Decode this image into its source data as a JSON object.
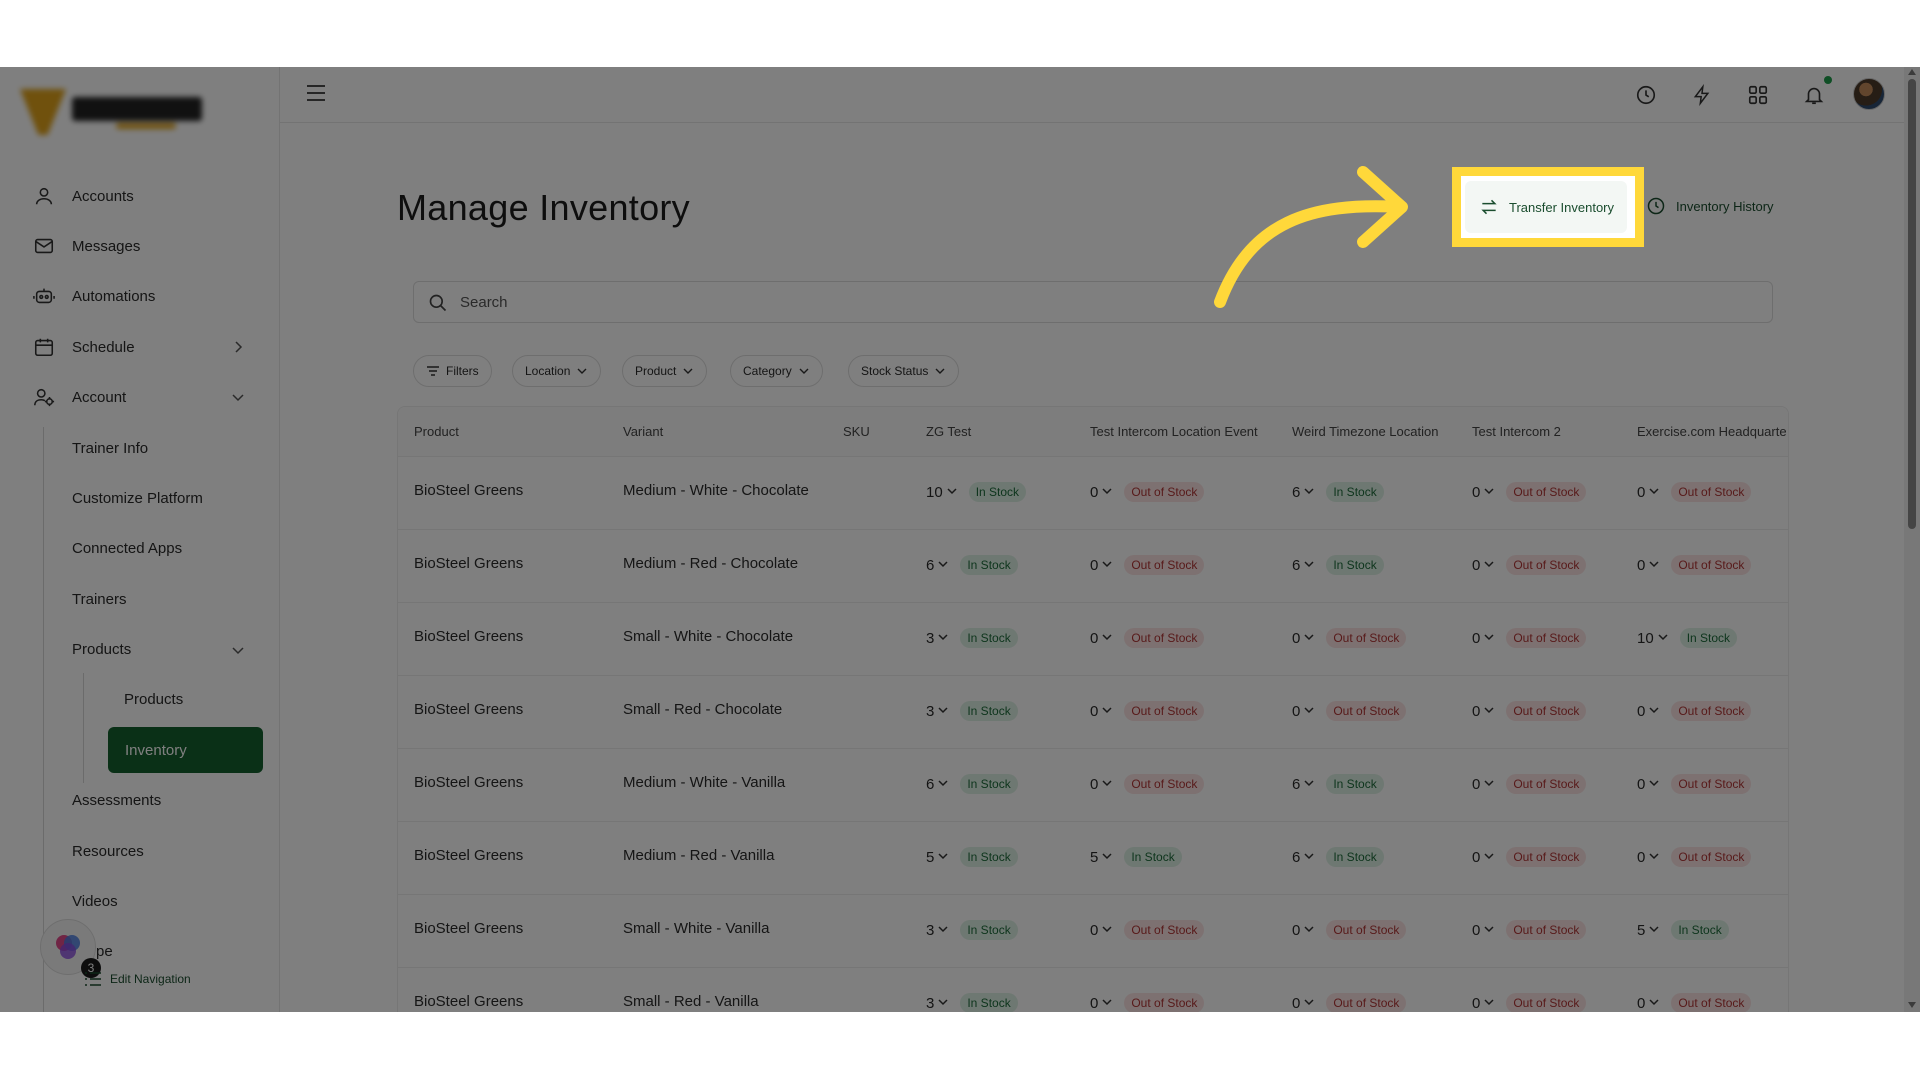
{
  "sidebar": {
    "items": [
      {
        "label": "Accounts",
        "icon": "user-icon"
      },
      {
        "label": "Messages",
        "icon": "mail-icon"
      },
      {
        "label": "Automations",
        "icon": "robot-icon"
      },
      {
        "label": "Schedule",
        "icon": "calendar-icon"
      },
      {
        "label": "Account",
        "icon": "user-gear-icon"
      }
    ],
    "account_sub": [
      "Trainer Info",
      "Customize Platform",
      "Connected Apps",
      "Trainers",
      "Products",
      "Assessments",
      "Resources",
      "Videos"
    ],
    "products_sub": [
      "Products",
      "Inventory"
    ],
    "partial_item": "pe",
    "edit_navigation": "Edit Navigation",
    "helper_count": "3"
  },
  "page": {
    "title": "Manage Inventory",
    "transfer_label": "Transfer Inventory",
    "history_label": "Inventory History",
    "search_placeholder": "Search"
  },
  "filters": [
    "Filters",
    "Location",
    "Product",
    "Category",
    "Stock Status"
  ],
  "table": {
    "columns": [
      "Product",
      "Variant",
      "SKU",
      "ZG Test",
      "Test Intercom Location Event",
      "Weird Timezone Location",
      "Test Intercom 2",
      "Exercise.com Headquarte"
    ],
    "rows": [
      {
        "product": "BioSteel Greens",
        "variant": "Medium - White - Chocolate",
        "sku": "",
        "stock": [
          {
            "qty": "10",
            "status": "In Stock"
          },
          {
            "qty": "0",
            "status": "Out of Stock"
          },
          {
            "qty": "6",
            "status": "In Stock"
          },
          {
            "qty": "0",
            "status": "Out of Stock"
          },
          {
            "qty": "0",
            "status": "Out of Stock"
          }
        ]
      },
      {
        "product": "BioSteel Greens",
        "variant": "Medium - Red - Chocolate",
        "sku": "",
        "stock": [
          {
            "qty": "6",
            "status": "In Stock"
          },
          {
            "qty": "0",
            "status": "Out of Stock"
          },
          {
            "qty": "6",
            "status": "In Stock"
          },
          {
            "qty": "0",
            "status": "Out of Stock"
          },
          {
            "qty": "0",
            "status": "Out of Stock"
          }
        ]
      },
      {
        "product": "BioSteel Greens",
        "variant": "Small - White - Chocolate",
        "sku": "",
        "stock": [
          {
            "qty": "3",
            "status": "In Stock"
          },
          {
            "qty": "0",
            "status": "Out of Stock"
          },
          {
            "qty": "0",
            "status": "Out of Stock"
          },
          {
            "qty": "0",
            "status": "Out of Stock"
          },
          {
            "qty": "10",
            "status": "In Stock"
          }
        ]
      },
      {
        "product": "BioSteel Greens",
        "variant": "Small - Red - Chocolate",
        "sku": "",
        "stock": [
          {
            "qty": "3",
            "status": "In Stock"
          },
          {
            "qty": "0",
            "status": "Out of Stock"
          },
          {
            "qty": "0",
            "status": "Out of Stock"
          },
          {
            "qty": "0",
            "status": "Out of Stock"
          },
          {
            "qty": "0",
            "status": "Out of Stock"
          }
        ]
      },
      {
        "product": "BioSteel Greens",
        "variant": "Medium - White - Vanilla",
        "sku": "",
        "stock": [
          {
            "qty": "6",
            "status": "In Stock"
          },
          {
            "qty": "0",
            "status": "Out of Stock"
          },
          {
            "qty": "6",
            "status": "In Stock"
          },
          {
            "qty": "0",
            "status": "Out of Stock"
          },
          {
            "qty": "0",
            "status": "Out of Stock"
          }
        ]
      },
      {
        "product": "BioSteel Greens",
        "variant": "Medium - Red - Vanilla",
        "sku": "",
        "stock": [
          {
            "qty": "5",
            "status": "In Stock"
          },
          {
            "qty": "5",
            "status": "In Stock"
          },
          {
            "qty": "6",
            "status": "In Stock"
          },
          {
            "qty": "0",
            "status": "Out of Stock"
          },
          {
            "qty": "0",
            "status": "Out of Stock"
          }
        ]
      },
      {
        "product": "BioSteel Greens",
        "variant": "Small - White - Vanilla",
        "sku": "",
        "stock": [
          {
            "qty": "3",
            "status": "In Stock"
          },
          {
            "qty": "0",
            "status": "Out of Stock"
          },
          {
            "qty": "0",
            "status": "Out of Stock"
          },
          {
            "qty": "0",
            "status": "Out of Stock"
          },
          {
            "qty": "5",
            "status": "In Stock"
          }
        ]
      },
      {
        "product": "BioSteel Greens",
        "variant": "Small - Red - Vanilla",
        "sku": "",
        "stock": [
          {
            "qty": "3",
            "status": "In Stock"
          },
          {
            "qty": "0",
            "status": "Out of Stock"
          },
          {
            "qty": "0",
            "status": "Out of Stock"
          },
          {
            "qty": "0",
            "status": "Out of Stock"
          },
          {
            "qty": "0",
            "status": "Out of Stock"
          }
        ]
      }
    ]
  },
  "colors": {
    "brand_green": "#14602e",
    "highlight_yellow": "#ffd83a",
    "in_stock_bg": "#ddf1e4",
    "out_stock_bg": "#fbe3e3"
  }
}
